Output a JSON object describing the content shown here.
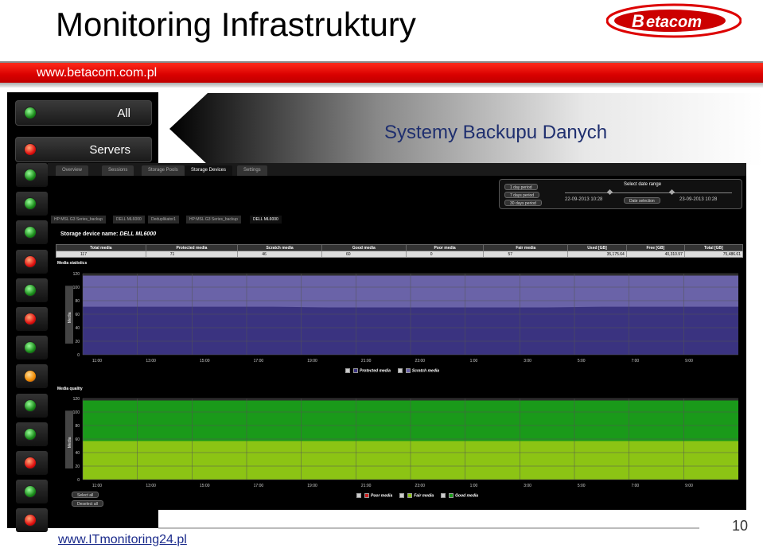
{
  "slide": {
    "title": "Monitoring Infrastruktury",
    "logo_text": "Betacom",
    "url": "www.betacom.com.pl",
    "subtitle": "Systemy Backupu Danych",
    "footer_url": "www.ITmonitoring24.pl",
    "page_number": "10"
  },
  "left_panel": {
    "buttons": [
      {
        "label": "All",
        "led": "green"
      },
      {
        "label": "Servers",
        "led": "red"
      }
    ],
    "leds": [
      "green",
      "green",
      "green",
      "red",
      "green",
      "red",
      "green",
      "orange",
      "green",
      "green",
      "red",
      "green",
      "red"
    ]
  },
  "app": {
    "tabs": [
      "Overview",
      "Sessions",
      "Storage Pools",
      "Storage Devices",
      "Settings"
    ],
    "active_tab": "Storage Devices",
    "period_buttons": [
      "1 day period",
      "7 days period",
      "30 days period"
    ],
    "select_date_range_label": "Select date range",
    "date_from": "22-09-2013 10:28",
    "date_to": "23-09-2013 10:28",
    "date_selection_button": "Date selection",
    "device_tabs": [
      "HP:MSL G3 Series_backup",
      "DELL ML6000",
      "Deduplikator1",
      "HP:MSL G3 Series_backup",
      "DELL ML6000"
    ],
    "device_label": "Storage device name:",
    "device_name": "DELL ML6000",
    "table": {
      "headers": [
        "Total media",
        "Protected media",
        "Scratch media",
        "Good media",
        "Poor media",
        "Fair media",
        "Used [GB]",
        "Free [GB]",
        "Total [GB]"
      ],
      "row": [
        "117",
        "71",
        "46",
        "60",
        "0",
        "57",
        "35,175.64",
        "40,310.97",
        "75,486.61"
      ]
    },
    "media_statistics_label": "Media statistics",
    "media_quality_label": "Media quality",
    "y_axis_label": "Media",
    "select_all": "Select all",
    "deselect_all": "Deselect all"
  },
  "chart_data": [
    {
      "type": "area",
      "title": "Media statistics",
      "ylabel": "Media",
      "ylim": [
        0,
        120
      ],
      "yticks": [
        0,
        20,
        40,
        60,
        80,
        100,
        120
      ],
      "x": [
        "11:00",
        "13:00",
        "15:00",
        "17:00",
        "19:00",
        "21:00",
        "23:00",
        "1:00",
        "3:00",
        "5:00",
        "7:00",
        "9:00"
      ],
      "series": [
        {
          "name": "Protected media",
          "color": "#3a3380",
          "values": [
            71,
            71,
            71,
            71,
            70,
            70,
            70,
            70,
            70,
            71,
            71,
            71
          ]
        },
        {
          "name": "Scratch media",
          "color": "#6a63a8",
          "values": [
            117,
            117,
            117,
            117,
            117,
            117,
            117,
            117,
            117,
            117,
            117,
            117
          ]
        }
      ],
      "grid": true,
      "legend": "bottom"
    },
    {
      "type": "area",
      "title": "Media quality",
      "ylabel": "Media",
      "ylim": [
        0,
        120
      ],
      "yticks": [
        0,
        20,
        40,
        60,
        80,
        100,
        120
      ],
      "x": [
        "11:00",
        "13:00",
        "15:00",
        "17:00",
        "19:00",
        "21:00",
        "23:00",
        "1:00",
        "3:00",
        "5:00",
        "7:00",
        "9:00"
      ],
      "series": [
        {
          "name": "Poor media",
          "color": "#cc2020",
          "values": [
            0,
            0,
            0,
            0,
            0,
            0,
            0,
            0,
            0,
            0,
            0,
            0
          ]
        },
        {
          "name": "Fair media",
          "color": "#8cc414",
          "values": [
            57,
            57,
            57,
            57,
            57,
            57,
            57,
            57,
            57,
            57,
            57,
            57
          ]
        },
        {
          "name": "Good media",
          "color": "#1a9a1a",
          "values": [
            117,
            117,
            117,
            117,
            117,
            117,
            117,
            117,
            117,
            117,
            117,
            117
          ]
        }
      ],
      "grid": true,
      "legend": "bottom"
    }
  ]
}
